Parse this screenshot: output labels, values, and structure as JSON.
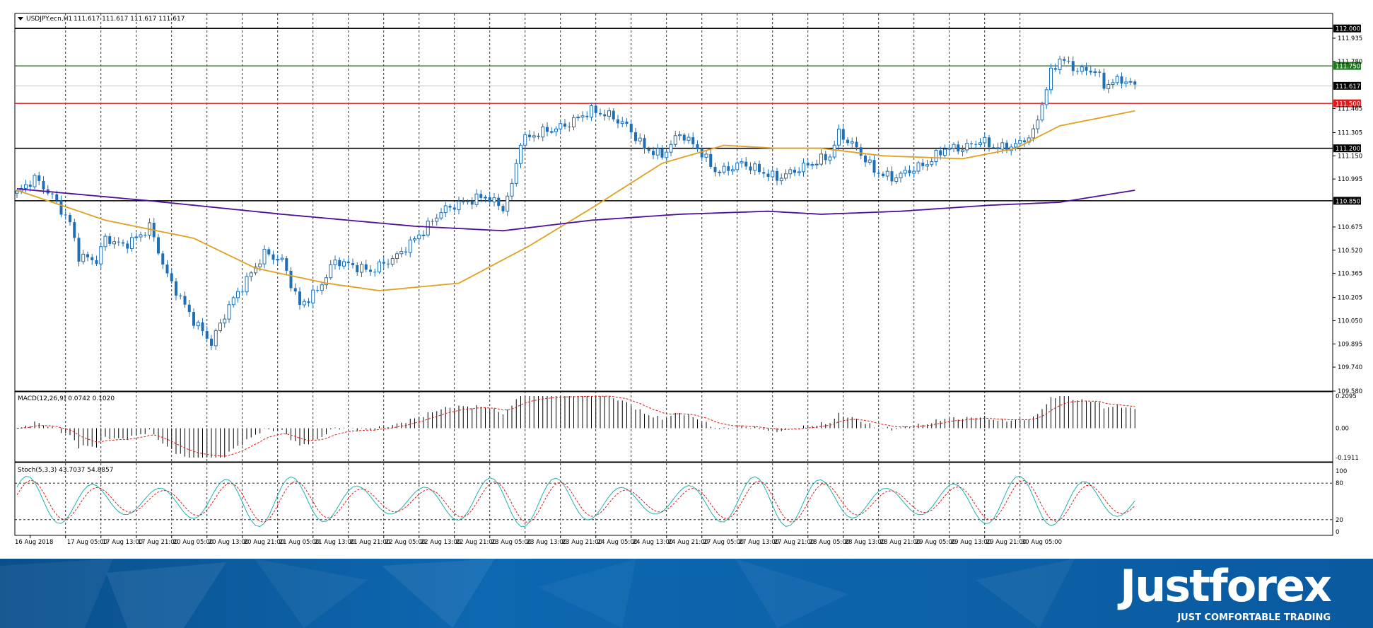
{
  "header": {
    "symbol": "USDJPY.ecn,H1",
    "ohlc": "111.617 111.617 111.617 111.617"
  },
  "price_levels": [
    {
      "label": "112.000",
      "value": 112.0,
      "color": "#000000"
    },
    {
      "label": "111.750",
      "value": 111.75,
      "color": "#1f7a1f"
    },
    {
      "label": "111.500",
      "value": 111.5,
      "color": "#e01a1a"
    },
    {
      "label": "111.200",
      "value": 111.2,
      "color": "#000000"
    },
    {
      "label": "110.850",
      "value": 110.85,
      "color": "#000000"
    }
  ],
  "current_price_label": "111.617",
  "macd": {
    "title": "MACD(12,26,9) 0.0742 0.1020",
    "ticks": [
      "0.2095",
      "0.00",
      "-0.1911"
    ]
  },
  "stoch": {
    "title": "Stoch(5,3,3) 43.7037 54.8857",
    "ticks": [
      "100",
      "80",
      "20",
      "0"
    ]
  },
  "brand": {
    "name": "Justforex",
    "tagline": "JUST COMFORTABLE TRADING"
  },
  "chart_data": {
    "type": "candlestick",
    "symbol": "USDJPY.ecn",
    "timeframe": "H1",
    "y_ticks": [
      111.935,
      111.78,
      111.465,
      111.305,
      111.15,
      110.995,
      110.675,
      110.52,
      110.365,
      110.205,
      110.05,
      109.895,
      109.74,
      109.58
    ],
    "ylim": [
      109.58,
      112.1
    ],
    "x_labels": [
      "16 Aug 2018",
      "17 Aug 05:00",
      "17 Aug 13:00",
      "17 Aug 21:00",
      "20 Aug 05:00",
      "20 Aug 13:00",
      "20 Aug 21:00",
      "21 Aug 05:00",
      "21 Aug 13:00",
      "21 Aug 21:00",
      "22 Aug 05:00",
      "22 Aug 13:00",
      "22 Aug 21:00",
      "23 Aug 05:00",
      "23 Aug 13:00",
      "23 Aug 21:00",
      "24 Aug 05:00",
      "24 Aug 13:00",
      "24 Aug 21:00",
      "27 Aug 05:00",
      "27 Aug 13:00",
      "27 Aug 21:00",
      "28 Aug 05:00",
      "28 Aug 13:00",
      "28 Aug 21:00",
      "29 Aug 05:00",
      "29 Aug 13:00",
      "29 Aug 21:00",
      "30 Aug 05:00"
    ],
    "close_anchors": [
      [
        0,
        110.9
      ],
      [
        4,
        111.0
      ],
      [
        8,
        110.88
      ],
      [
        12,
        110.7
      ],
      [
        14,
        110.48
      ],
      [
        18,
        110.45
      ],
      [
        20,
        110.6
      ],
      [
        24,
        110.55
      ],
      [
        28,
        110.62
      ],
      [
        30,
        110.68
      ],
      [
        34,
        110.35
      ],
      [
        40,
        110.05
      ],
      [
        44,
        109.9
      ],
      [
        48,
        110.15
      ],
      [
        52,
        110.32
      ],
      [
        56,
        110.5
      ],
      [
        60,
        110.45
      ],
      [
        64,
        110.15
      ],
      [
        68,
        110.25
      ],
      [
        72,
        110.45
      ],
      [
        80,
        110.38
      ],
      [
        86,
        110.48
      ],
      [
        92,
        110.65
      ],
      [
        96,
        110.78
      ],
      [
        100,
        110.83
      ],
      [
        106,
        110.88
      ],
      [
        110,
        110.8
      ],
      [
        112,
        110.95
      ],
      [
        114,
        111.25
      ],
      [
        118,
        111.3
      ],
      [
        124,
        111.35
      ],
      [
        128,
        111.42
      ],
      [
        130,
        111.45
      ],
      [
        134,
        111.42
      ],
      [
        138,
        111.35
      ],
      [
        142,
        111.2
      ],
      [
        146,
        111.15
      ],
      [
        150,
        111.3
      ],
      [
        154,
        111.2
      ],
      [
        158,
        111.05
      ],
      [
        160,
        111.05
      ],
      [
        164,
        111.1
      ],
      [
        168,
        111.05
      ],
      [
        172,
        111.0
      ],
      [
        176,
        111.05
      ],
      [
        180,
        111.1
      ],
      [
        184,
        111.15
      ],
      [
        186,
        111.3
      ],
      [
        190,
        111.2
      ],
      [
        194,
        111.05
      ],
      [
        198,
        111.0
      ],
      [
        202,
        111.05
      ],
      [
        206,
        111.1
      ],
      [
        210,
        111.2
      ],
      [
        214,
        111.2
      ],
      [
        218,
        111.25
      ],
      [
        222,
        111.2
      ],
      [
        226,
        111.22
      ],
      [
        230,
        111.3
      ],
      [
        234,
        111.7
      ],
      [
        236,
        111.8
      ],
      [
        240,
        111.72
      ],
      [
        244,
        111.72
      ],
      [
        246,
        111.62
      ],
      [
        250,
        111.66
      ],
      [
        253,
        111.617
      ]
    ],
    "ma_fast_anchors": [
      [
        0,
        110.92
      ],
      [
        20,
        110.72
      ],
      [
        40,
        110.6
      ],
      [
        54,
        110.4
      ],
      [
        70,
        110.3
      ],
      [
        82,
        110.25
      ],
      [
        100,
        110.3
      ],
      [
        116,
        110.55
      ],
      [
        130,
        110.8
      ],
      [
        146,
        111.1
      ],
      [
        160,
        111.22
      ],
      [
        172,
        111.2
      ],
      [
        182,
        111.2
      ],
      [
        196,
        111.15
      ],
      [
        214,
        111.13
      ],
      [
        226,
        111.2
      ],
      [
        236,
        111.35
      ],
      [
        253,
        111.45
      ]
    ],
    "ma_slow_anchors": [
      [
        0,
        110.93
      ],
      [
        30,
        110.85
      ],
      [
        60,
        110.76
      ],
      [
        90,
        110.68
      ],
      [
        110,
        110.65
      ],
      [
        130,
        110.72
      ],
      [
        150,
        110.76
      ],
      [
        170,
        110.78
      ],
      [
        182,
        110.76
      ],
      [
        200,
        110.78
      ],
      [
        220,
        110.82
      ],
      [
        236,
        110.84
      ],
      [
        253,
        110.92
      ]
    ]
  }
}
